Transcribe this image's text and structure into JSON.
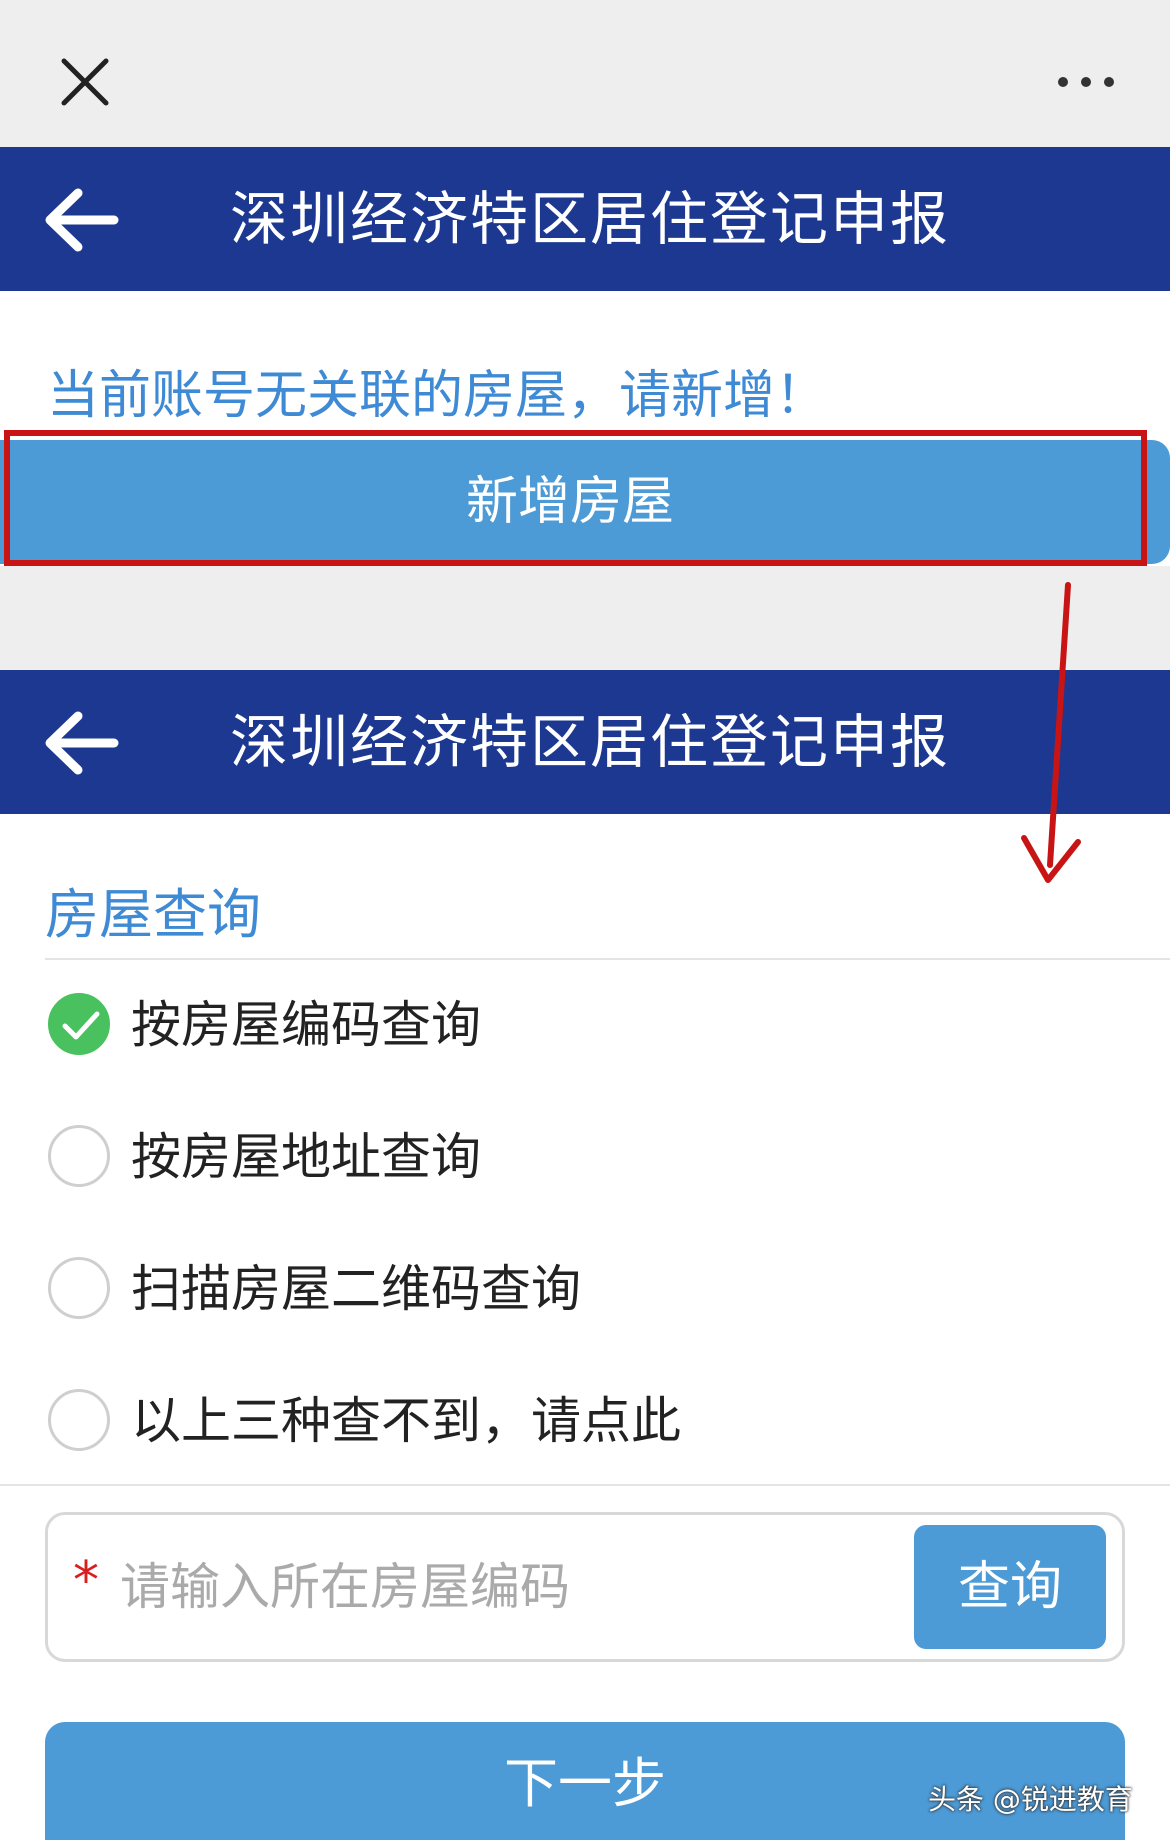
{
  "screen1": {
    "header_title": "深圳经济特区居住登记申报",
    "notice": "当前账号无关联的房屋，请新增！",
    "add_button_label": "新增房屋"
  },
  "screen2": {
    "header_title": "深圳经济特区居住登记申报",
    "section_title": "房屋查询",
    "options": [
      {
        "label": "按房屋编码查询",
        "checked": true
      },
      {
        "label": "按房屋地址查询",
        "checked": false
      },
      {
        "label": "扫描房屋二维码查询",
        "checked": false
      },
      {
        "label": "以上三种查不到，请点此",
        "checked": false
      }
    ],
    "search": {
      "required_mark": "*",
      "placeholder": "请输入所在房屋编码",
      "value": "",
      "button_label": "查询"
    },
    "next_button_label": "下一步"
  },
  "watermark": "头条 @锐进教育",
  "colors": {
    "header_bg": "#1c3891",
    "accent_blue": "#4c9ad6",
    "link_blue": "#3f8ad4",
    "highlight_red": "#c81414",
    "check_green": "#49c15f"
  },
  "icons": {
    "close": "close-icon",
    "more": "more-icon",
    "back": "back-arrow-icon",
    "checked": "check-icon"
  }
}
